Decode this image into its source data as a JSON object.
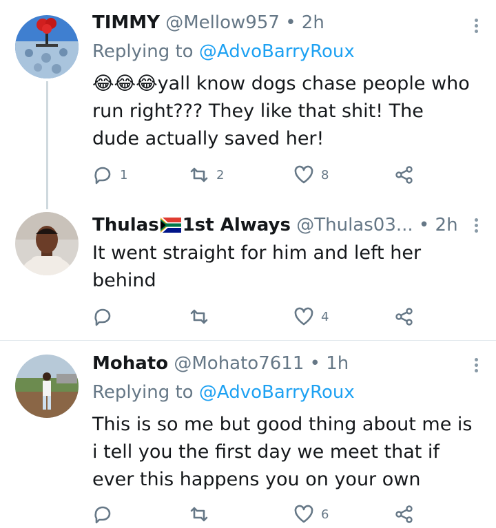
{
  "tweets": [
    {
      "name": "TIMMY",
      "handle": "@Mellow957",
      "time": "• 2h",
      "replying_prefix": "Replying to",
      "replying_to": "@AdvoBarryRoux",
      "emoji": "😂😂😂",
      "text": "yall know dogs chase people who run right??? They like that shit! The dude actually saved her!",
      "replies": "1",
      "retweets": "2",
      "likes": "8"
    },
    {
      "name": "Thulas",
      "name_suffix": "1st Always",
      "handle": "@Thulas03...",
      "time": "• 2h",
      "text": "It went straight for him and left her behind",
      "replies": "",
      "retweets": "",
      "likes": "4"
    },
    {
      "name": "Mohato",
      "handle": "@Mohato7611",
      "time": "• 1h",
      "replying_prefix": "Replying to",
      "replying_to": "@AdvoBarryRoux",
      "text": "This is so me but good thing about me is i tell you the first day we meet that if ever this happens you on your own",
      "replies": "",
      "retweets": "",
      "likes": "6"
    }
  ],
  "icons": {
    "reply": "reply-icon",
    "retweet": "retweet-icon",
    "like": "heart-icon",
    "share": "share-icon",
    "more": "more-options-icon",
    "flag": "south-africa-flag-icon"
  },
  "colors": {
    "text": "#14171a",
    "secondary": "#657786",
    "link": "#1da1f2",
    "divider": "#e1e8ed"
  }
}
